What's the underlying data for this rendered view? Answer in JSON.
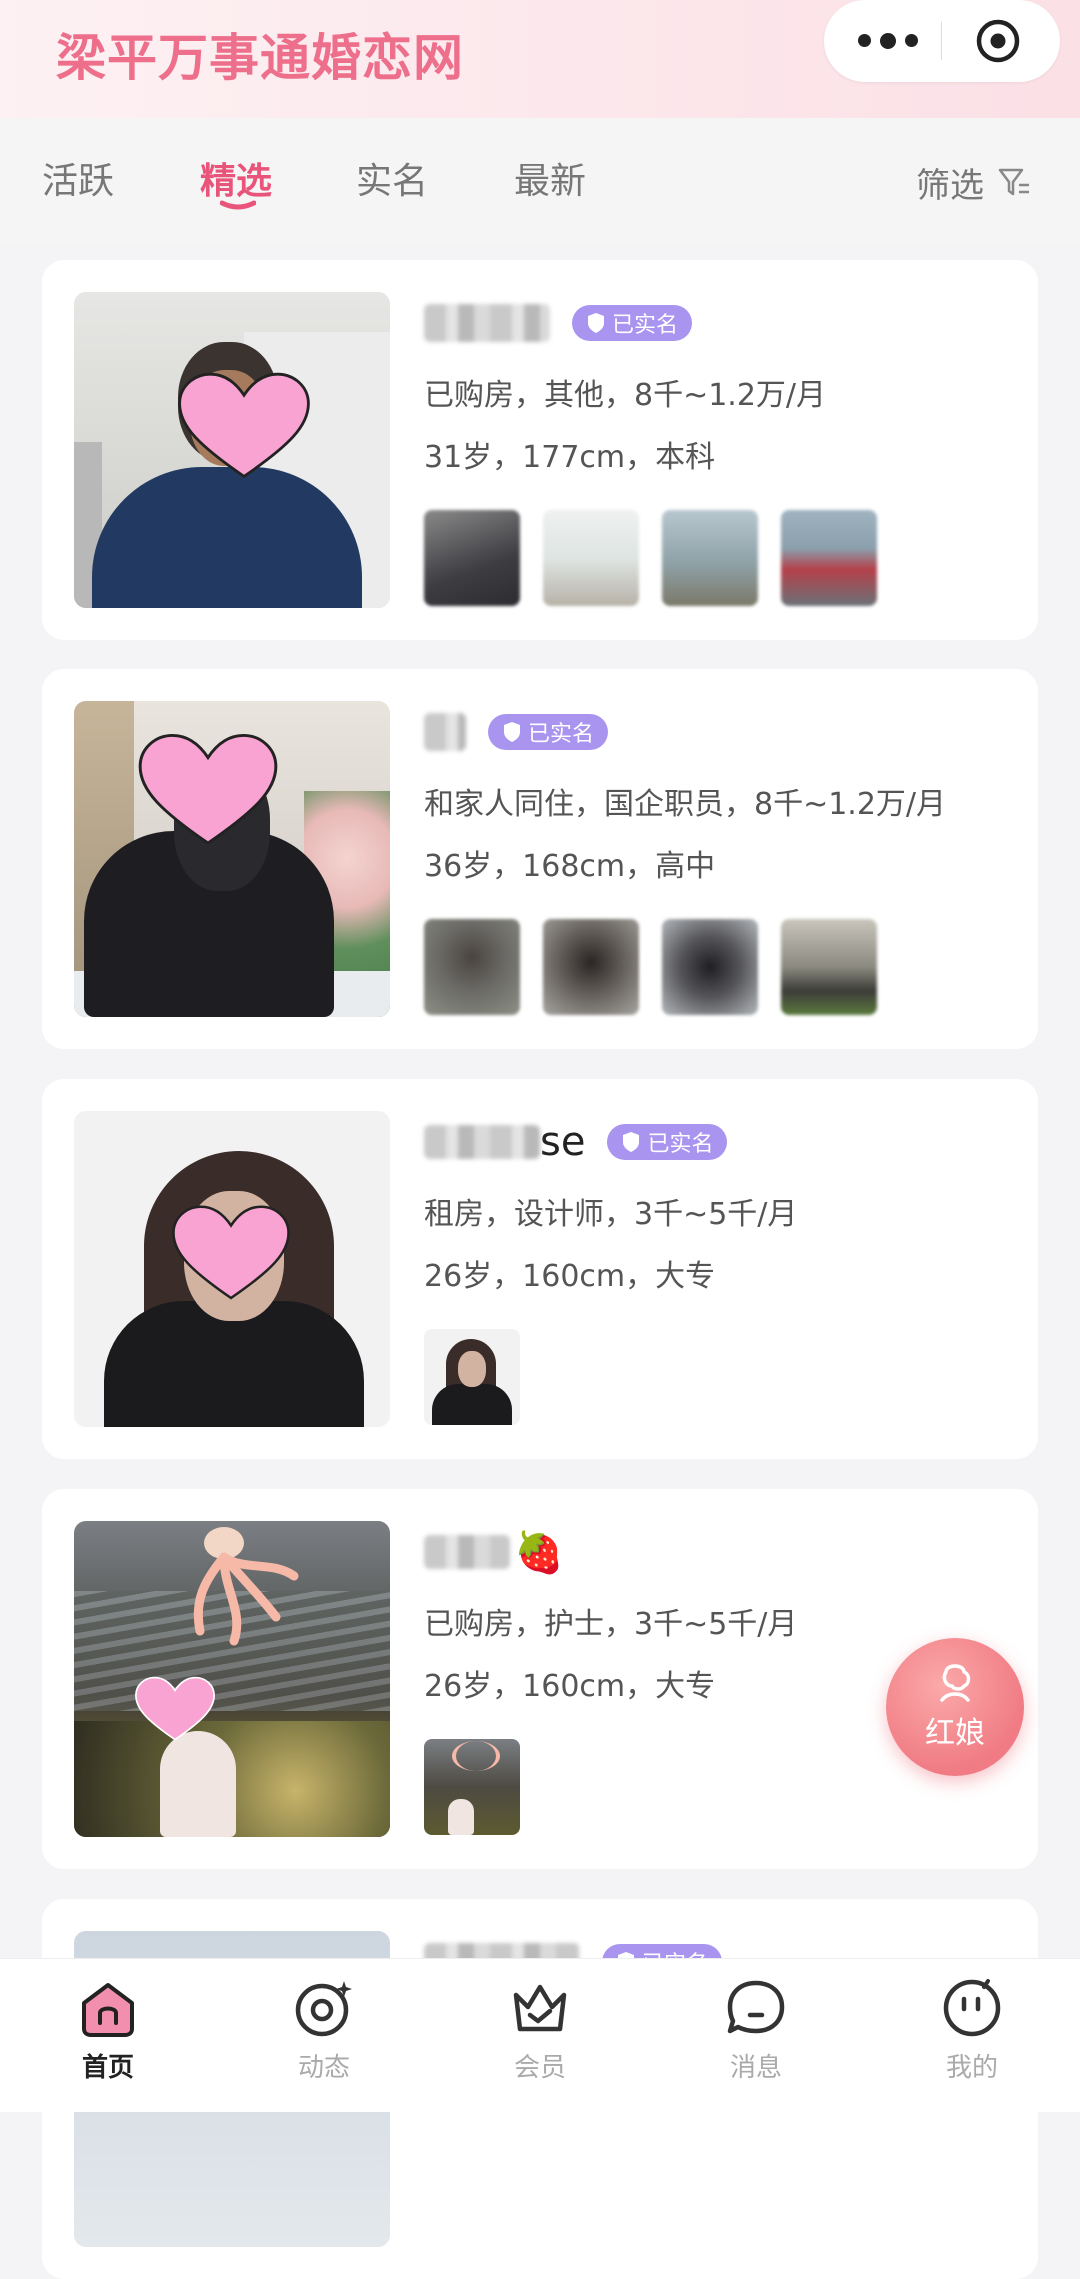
{
  "app": {
    "title": "梁平万事通婚恋网"
  },
  "tabs": [
    {
      "label": "活跃"
    },
    {
      "label": "精选"
    },
    {
      "label": "实名"
    },
    {
      "label": "最新"
    }
  ],
  "active_tab": "精选",
  "filter": {
    "label": "筛选"
  },
  "badge_text": "已实名",
  "profiles": [
    {
      "name_visible": "",
      "verified": true,
      "info": "已购房，其他，8千~1.2万/月",
      "stats": "31岁，177cm，本科",
      "thumb_count": 4
    },
    {
      "name_visible": "",
      "verified": true,
      "info": "和家人同住，国企职员，8千~1.2万/月",
      "stats": "36岁，168cm，高中",
      "thumb_count": 4
    },
    {
      "name_visible": "se",
      "verified": true,
      "info": "租房，设计师，3千~5千/月",
      "stats": "26岁，160cm，大专",
      "thumb_count": 1
    },
    {
      "name_visible": "🍓",
      "verified": false,
      "info": "已购房，护士，3千~5千/月",
      "stats": "26岁，160cm，大专",
      "thumb_count": 1
    },
    {
      "name_visible": "",
      "verified": true,
      "info": "",
      "stats": "",
      "thumb_count": 0
    }
  ],
  "fab": {
    "label": "红娘"
  },
  "bottom_nav": [
    {
      "label": "首页",
      "icon": "home-icon",
      "active": true
    },
    {
      "label": "动态",
      "icon": "moments-icon",
      "active": false
    },
    {
      "label": "会员",
      "icon": "crown-icon",
      "active": false
    },
    {
      "label": "消息",
      "icon": "message-icon",
      "active": false
    },
    {
      "label": "我的",
      "icon": "profile-icon",
      "active": false
    }
  ],
  "colors": {
    "accent": "#e9557a",
    "badge": "#a995f0",
    "heart": "#f9a3d2",
    "fab": "#f07b84"
  }
}
